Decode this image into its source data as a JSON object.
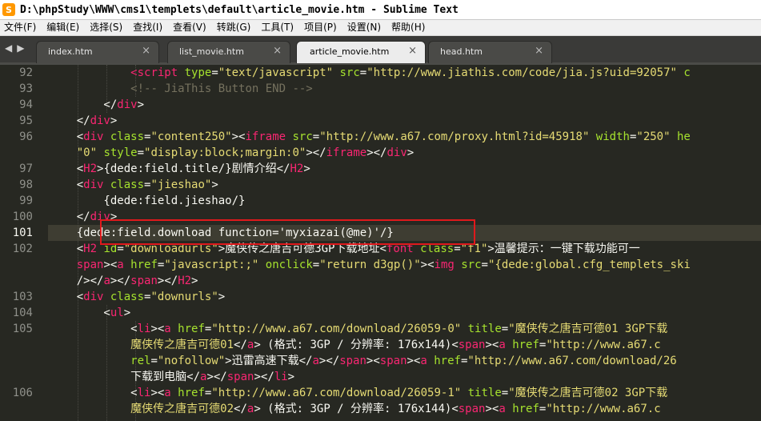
{
  "window": {
    "title": "D:\\phpStudy\\WWW\\cms1\\templets\\default\\article_movie.htm - Sublime Text"
  },
  "menu": [
    {
      "label": "文件(F)"
    },
    {
      "label": "编辑(E)"
    },
    {
      "label": "选择(S)"
    },
    {
      "label": "查找(I)"
    },
    {
      "label": "查看(V)"
    },
    {
      "label": "转跳(G)"
    },
    {
      "label": "工具(T)"
    },
    {
      "label": "项目(P)"
    },
    {
      "label": "设置(N)"
    },
    {
      "label": "帮助(H)"
    }
  ],
  "nav": {
    "back": "◀",
    "forward": "▶"
  },
  "tabs": [
    {
      "label": "index.htm",
      "close": "×",
      "active": false
    },
    {
      "label": "list_movie.htm",
      "close": "×",
      "active": false
    },
    {
      "label": "article_movie.htm",
      "close": "×",
      "active": true
    },
    {
      "label": "head.htm",
      "close": "×",
      "active": false
    }
  ],
  "gutter": [
    "92",
    "93",
    "94",
    "95",
    "96",
    "",
    "97",
    "98",
    "99",
    "100",
    "101",
    "102",
    "",
    "",
    "103",
    "104",
    "105",
    "",
    "",
    "",
    "106",
    ""
  ],
  "current_line": "101",
  "code_lines": [
    [
      {
        "c": "p",
        "t": "            "
      },
      {
        "c": "t",
        "t": "<script"
      },
      {
        "c": "a",
        "t": " type"
      },
      {
        "c": "p",
        "t": "="
      },
      {
        "c": "s",
        "t": "\"text/javascript\""
      },
      {
        "c": "a",
        "t": " src"
      },
      {
        "c": "p",
        "t": "="
      },
      {
        "c": "s",
        "t": "\"http://www.jiathis.com/code/jia.js?uid=92057\""
      },
      {
        "c": "a",
        "t": " c"
      }
    ],
    [
      {
        "c": "p",
        "t": "            "
      },
      {
        "c": "c",
        "t": "<!-- JiaThis Button END -->"
      }
    ],
    [
      {
        "c": "p",
        "t": "        </"
      },
      {
        "c": "t",
        "t": "div"
      },
      {
        "c": "p",
        "t": ">"
      }
    ],
    [
      {
        "c": "p",
        "t": "    </"
      },
      {
        "c": "t",
        "t": "div"
      },
      {
        "c": "p",
        "t": ">"
      }
    ],
    [
      {
        "c": "p",
        "t": "    <"
      },
      {
        "c": "t",
        "t": "div"
      },
      {
        "c": "a",
        "t": " class"
      },
      {
        "c": "p",
        "t": "="
      },
      {
        "c": "s",
        "t": "\"content250\""
      },
      {
        "c": "p",
        "t": "><"
      },
      {
        "c": "t",
        "t": "iframe"
      },
      {
        "c": "a",
        "t": " src"
      },
      {
        "c": "p",
        "t": "="
      },
      {
        "c": "s",
        "t": "\"http://www.a67.com/proxy.html?id=45918\""
      },
      {
        "c": "a",
        "t": " width"
      },
      {
        "c": "p",
        "t": "="
      },
      {
        "c": "s",
        "t": "\"250\""
      },
      {
        "c": "a",
        "t": " he"
      }
    ],
    [
      {
        "c": "p",
        "t": "    "
      },
      {
        "c": "s",
        "t": "\"0\""
      },
      {
        "c": "a",
        "t": " style"
      },
      {
        "c": "p",
        "t": "="
      },
      {
        "c": "s",
        "t": "\"display:block;margin:0\""
      },
      {
        "c": "p",
        "t": "></"
      },
      {
        "c": "t",
        "t": "iframe"
      },
      {
        "c": "p",
        "t": "></"
      },
      {
        "c": "t",
        "t": "div"
      },
      {
        "c": "p",
        "t": ">"
      }
    ],
    [
      {
        "c": "p",
        "t": "    <"
      },
      {
        "c": "t",
        "t": "H2"
      },
      {
        "c": "p",
        "t": ">{dede:field.title/}剧情介绍</"
      },
      {
        "c": "t",
        "t": "H2"
      },
      {
        "c": "p",
        "t": ">"
      }
    ],
    [
      {
        "c": "p",
        "t": "    <"
      },
      {
        "c": "t",
        "t": "div"
      },
      {
        "c": "a",
        "t": " class"
      },
      {
        "c": "p",
        "t": "="
      },
      {
        "c": "s",
        "t": "\"jieshao\""
      },
      {
        "c": "p",
        "t": ">"
      }
    ],
    [
      {
        "c": "p",
        "t": "        {dede:field.jieshao/}"
      }
    ],
    [
      {
        "c": "p",
        "t": "    </"
      },
      {
        "c": "t",
        "t": "div"
      },
      {
        "c": "p",
        "t": ">"
      }
    ],
    [
      {
        "c": "p",
        "t": "    {dede:field.download function='myxiazai(@me)'/}"
      }
    ],
    [
      {
        "c": "p",
        "t": "    <"
      },
      {
        "c": "t",
        "t": "H2"
      },
      {
        "c": "a",
        "t": " id"
      },
      {
        "c": "p",
        "t": "="
      },
      {
        "c": "s",
        "t": "\"downloadurls\""
      },
      {
        "c": "p",
        "t": ">魔侠传之唐吉可德3GP下载地址<"
      },
      {
        "c": "t",
        "t": "font"
      },
      {
        "c": "a",
        "t": " class"
      },
      {
        "c": "p",
        "t": "="
      },
      {
        "c": "s",
        "t": "\"f1\""
      },
      {
        "c": "p",
        "t": ">温馨提示：一键下载功能可一"
      }
    ],
    [
      {
        "c": "t",
        "t": "    span"
      },
      {
        "c": "p",
        "t": "><"
      },
      {
        "c": "t",
        "t": "a"
      },
      {
        "c": "a",
        "t": " href"
      },
      {
        "c": "p",
        "t": "="
      },
      {
        "c": "s",
        "t": "\"javascript:;\""
      },
      {
        "c": "a",
        "t": " onclick"
      },
      {
        "c": "p",
        "t": "="
      },
      {
        "c": "s",
        "t": "\"return d3gp()\""
      },
      {
        "c": "p",
        "t": "><"
      },
      {
        "c": "t",
        "t": "img"
      },
      {
        "c": "a",
        "t": " src"
      },
      {
        "c": "p",
        "t": "="
      },
      {
        "c": "s",
        "t": "\"{dede:global.cfg_templets_ski"
      }
    ],
    [
      {
        "c": "p",
        "t": "    /></"
      },
      {
        "c": "t",
        "t": "a"
      },
      {
        "c": "p",
        "t": "></"
      },
      {
        "c": "t",
        "t": "span"
      },
      {
        "c": "p",
        "t": "></"
      },
      {
        "c": "t",
        "t": "H2"
      },
      {
        "c": "p",
        "t": ">"
      }
    ],
    [
      {
        "c": "p",
        "t": "    <"
      },
      {
        "c": "t",
        "t": "div"
      },
      {
        "c": "a",
        "t": " class"
      },
      {
        "c": "p",
        "t": "="
      },
      {
        "c": "s",
        "t": "\"downurls\""
      },
      {
        "c": "p",
        "t": ">"
      }
    ],
    [
      {
        "c": "p",
        "t": "        <"
      },
      {
        "c": "t",
        "t": "ul"
      },
      {
        "c": "p",
        "t": ">"
      }
    ],
    [
      {
        "c": "p",
        "t": "            <"
      },
      {
        "c": "t",
        "t": "li"
      },
      {
        "c": "p",
        "t": "><"
      },
      {
        "c": "t",
        "t": "a"
      },
      {
        "c": "a",
        "t": " href"
      },
      {
        "c": "p",
        "t": "="
      },
      {
        "c": "s",
        "t": "\"http://www.a67.com/download/26059-0\""
      },
      {
        "c": "a",
        "t": " title"
      },
      {
        "c": "p",
        "t": "="
      },
      {
        "c": "s",
        "t": "\"魔侠传之唐吉可德01 3GP下载"
      }
    ],
    [
      {
        "c": "s",
        "t": "            魔侠传之唐吉可德01"
      },
      {
        "c": "p",
        "t": "</"
      },
      {
        "c": "t",
        "t": "a"
      },
      {
        "c": "p",
        "t": "> (格式: 3GP / 分辨率: 176x144)<"
      },
      {
        "c": "t",
        "t": "span"
      },
      {
        "c": "p",
        "t": "><"
      },
      {
        "c": "t",
        "t": "a"
      },
      {
        "c": "a",
        "t": " href"
      },
      {
        "c": "p",
        "t": "="
      },
      {
        "c": "s",
        "t": "\"http://www.a67.c"
      }
    ],
    [
      {
        "c": "a",
        "t": "            rel"
      },
      {
        "c": "p",
        "t": "="
      },
      {
        "c": "s",
        "t": "\"nofollow\""
      },
      {
        "c": "p",
        "t": ">迅雷高速下载</"
      },
      {
        "c": "t",
        "t": "a"
      },
      {
        "c": "p",
        "t": "></"
      },
      {
        "c": "t",
        "t": "span"
      },
      {
        "c": "p",
        "t": "><"
      },
      {
        "c": "t",
        "t": "span"
      },
      {
        "c": "p",
        "t": "><"
      },
      {
        "c": "t",
        "t": "a"
      },
      {
        "c": "a",
        "t": " href"
      },
      {
        "c": "p",
        "t": "="
      },
      {
        "c": "s",
        "t": "\"http://www.a67.com/download/26"
      }
    ],
    [
      {
        "c": "p",
        "t": "            下载到电脑</"
      },
      {
        "c": "t",
        "t": "a"
      },
      {
        "c": "p",
        "t": "></"
      },
      {
        "c": "t",
        "t": "span"
      },
      {
        "c": "p",
        "t": "></"
      },
      {
        "c": "t",
        "t": "li"
      },
      {
        "c": "p",
        "t": ">"
      }
    ],
    [
      {
        "c": "p",
        "t": "            <"
      },
      {
        "c": "t",
        "t": "li"
      },
      {
        "c": "p",
        "t": "><"
      },
      {
        "c": "t",
        "t": "a"
      },
      {
        "c": "a",
        "t": " href"
      },
      {
        "c": "p",
        "t": "="
      },
      {
        "c": "s",
        "t": "\"http://www.a67.com/download/26059-1\""
      },
      {
        "c": "a",
        "t": " title"
      },
      {
        "c": "p",
        "t": "="
      },
      {
        "c": "s",
        "t": "\"魔侠传之唐吉可德02 3GP下载"
      }
    ],
    [
      {
        "c": "s",
        "t": "            魔侠传之唐吉可德02"
      },
      {
        "c": "p",
        "t": "</"
      },
      {
        "c": "t",
        "t": "a"
      },
      {
        "c": "p",
        "t": "> (格式: 3GP / 分辨率: 176x144)<"
      },
      {
        "c": "t",
        "t": "span"
      },
      {
        "c": "p",
        "t": "><"
      },
      {
        "c": "t",
        "t": "a"
      },
      {
        "c": "a",
        "t": " href"
      },
      {
        "c": "p",
        "t": "="
      },
      {
        "c": "s",
        "t": "\"http://www.a67.c"
      }
    ]
  ],
  "colors": {
    "background": "#272822",
    "tag": "#f92672",
    "attribute": "#a6e22e",
    "string": "#e6db74",
    "comment": "#75715e",
    "text": "#f8f8f2",
    "highlight_box": "#e0191c",
    "current_line_bg": "#3e3d32"
  }
}
